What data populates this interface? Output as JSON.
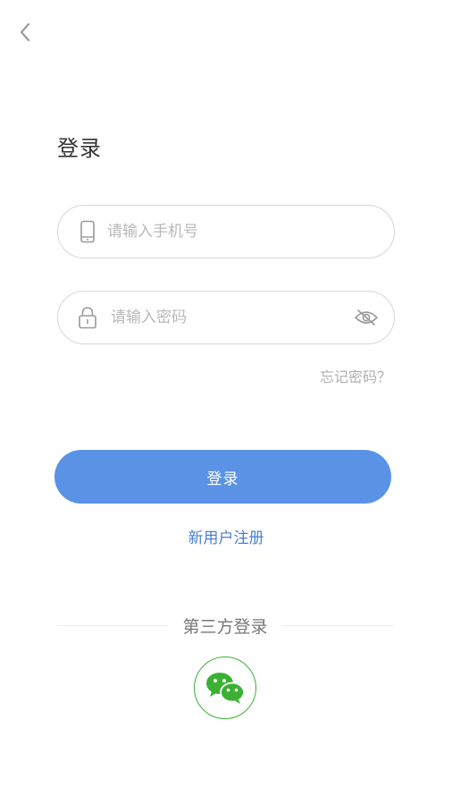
{
  "header": {
    "back_icon": "chevron-left-icon"
  },
  "page": {
    "title": "登录"
  },
  "form": {
    "phone": {
      "icon": "mobile-phone-icon",
      "placeholder": "请输入手机号",
      "value": ""
    },
    "password": {
      "icon": "lock-icon",
      "placeholder": "请输入密码",
      "value": "",
      "toggle_icon": "eye-off-icon"
    },
    "forgot_label": "忘记密码？",
    "login_label": "登录",
    "register_label": "新用户注册"
  },
  "third_party": {
    "label": "第三方登录",
    "wechat_icon": "wechat-icon"
  },
  "colors": {
    "primary": "#5a93e6",
    "link": "#4a7fd4",
    "wechat": "#3cb034",
    "placeholder": "#b8b8b8"
  }
}
